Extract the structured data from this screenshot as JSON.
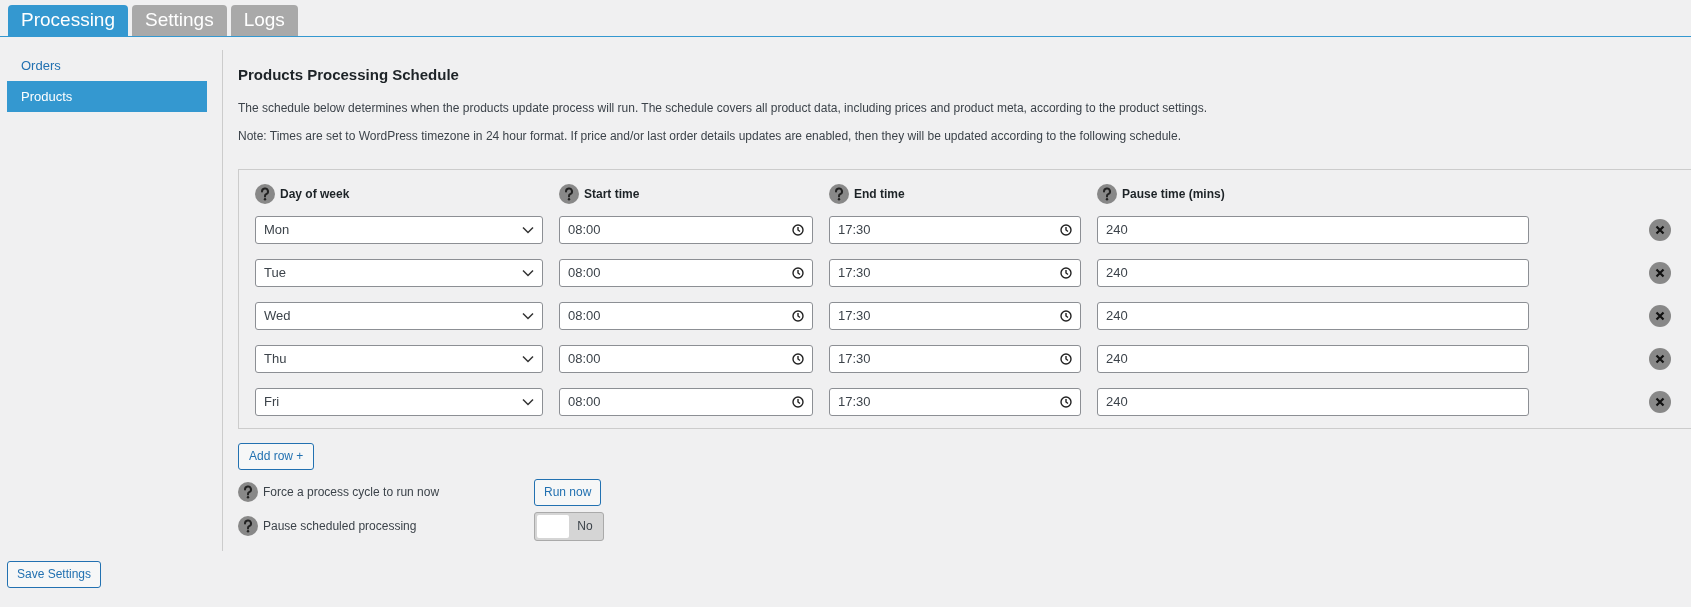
{
  "tabs": [
    {
      "label": "Processing",
      "selected": true
    },
    {
      "label": "Settings",
      "selected": false
    },
    {
      "label": "Logs",
      "selected": false
    }
  ],
  "sidebar": {
    "items": [
      {
        "label": "Orders",
        "selected": false
      },
      {
        "label": "Products",
        "selected": true
      }
    ]
  },
  "heading": "Products Processing Schedule",
  "description": "The schedule below determines when the products update process will run. The schedule covers all product data, including prices and product meta, according to the product settings.",
  "note": "Note: Times are set to WordPress timezone in 24 hour format. If price and/or last order details updates are enabled, then they will be updated according to the following schedule.",
  "table": {
    "columns": [
      "Day of week",
      "Start time",
      "End time",
      "Pause time (mins)"
    ],
    "rows": [
      {
        "day": "Mon",
        "start": "08:00",
        "end": "17:30",
        "pause": "240"
      },
      {
        "day": "Tue",
        "start": "08:00",
        "end": "17:30",
        "pause": "240"
      },
      {
        "day": "Wed",
        "start": "08:00",
        "end": "17:30",
        "pause": "240"
      },
      {
        "day": "Thu",
        "start": "08:00",
        "end": "17:30",
        "pause": "240"
      },
      {
        "day": "Fri",
        "start": "08:00",
        "end": "17:30",
        "pause": "240"
      }
    ]
  },
  "add_row_button": "Add row +",
  "force_cycle": {
    "label": "Force a process cycle to run now",
    "button": "Run now"
  },
  "pause_processing": {
    "label": "Pause scheduled processing",
    "on": false,
    "state_text": "No"
  },
  "save_button": "Save Settings"
}
